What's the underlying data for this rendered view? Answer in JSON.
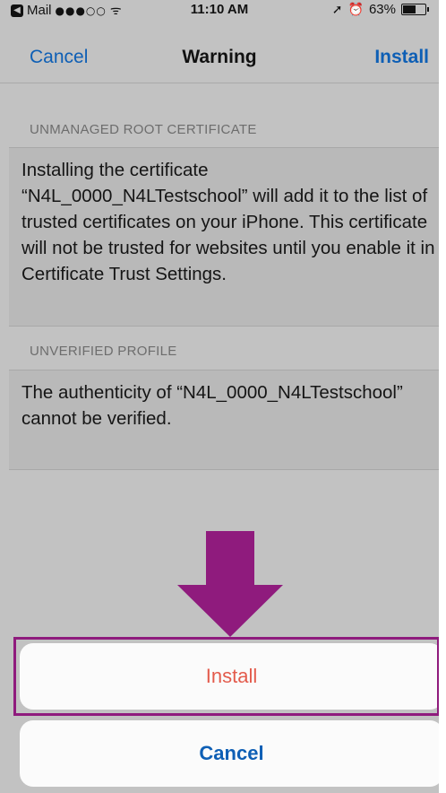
{
  "status_bar": {
    "back_app": "Mail",
    "back_glyph": "◀",
    "signal": "●●●○○",
    "wifi_glyph": "ᯤ",
    "time": "11:10 AM",
    "location_glyph": "➚",
    "alarm_glyph": "⏰",
    "battery_percent": "63%",
    "battery_level": 0.63
  },
  "nav": {
    "left_label": "Cancel",
    "title": "Warning",
    "right_label": "Install"
  },
  "sections": [
    {
      "header": "UNMANAGED ROOT CERTIFICATE",
      "body": "Installing the certificate “N4L_0000_N4LTestschool” will add it to the list of trusted certificates on your iPhone. This certificate will not be trusted for websites until you enable it in Certificate Trust Settings."
    },
    {
      "header": "UNVERIFIED PROFILE",
      "body": "The authenticity of “N4L_0000_N4LTestschool” cannot be verified."
    }
  ],
  "action_sheet": {
    "install_label": "Install",
    "cancel_label": "Cancel"
  },
  "colors": {
    "ios_blue": "#0e5fb5",
    "destructive_red": "#e35b4c",
    "annotation_purple": "#8f1b7d",
    "dimmed_background": "#c2c2c2"
  },
  "icons": [
    "back-arrow-icon",
    "signal-icon",
    "wifi-icon",
    "location-icon",
    "alarm-icon",
    "battery-icon",
    "annotation-arrow-icon"
  ]
}
